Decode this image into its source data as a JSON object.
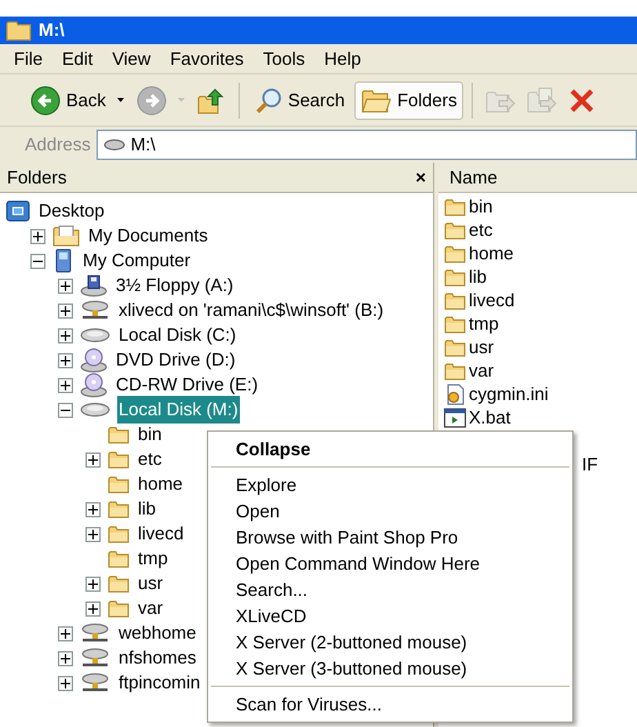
{
  "window": {
    "title": "M:\\"
  },
  "menu_bar": [
    "File",
    "Edit",
    "View",
    "Favorites",
    "Tools",
    "Help"
  ],
  "toolbar": [
    {
      "kind": "back",
      "label": "Back",
      "disabled": false
    },
    {
      "kind": "dropdown",
      "disabled": false
    },
    {
      "kind": "forward",
      "disabled": true
    },
    {
      "kind": "dropdown",
      "disabled": true
    },
    {
      "kind": "up",
      "disabled": false
    },
    {
      "kind": "separator"
    },
    {
      "kind": "search",
      "label": "Search",
      "selected": false
    },
    {
      "kind": "folders",
      "label": "Folders",
      "selected": true
    },
    {
      "kind": "separator"
    },
    {
      "kind": "move",
      "disabled": true
    },
    {
      "kind": "copy",
      "disabled": true
    },
    {
      "kind": "delete",
      "disabled": false
    }
  ],
  "address": {
    "label": "Address",
    "value": "M:\\"
  },
  "folders_pane": {
    "title": "Folders",
    "close": "×",
    "tree": [
      {
        "label": "Desktop",
        "kind": "desktop",
        "expandable": false,
        "selected": false,
        "children": [
          {
            "label": "My Documents",
            "kind": "documents",
            "expandable": true,
            "expanded": false,
            "selected": false
          },
          {
            "label": "My Computer",
            "kind": "computer",
            "expandable": true,
            "expanded": true,
            "selected": false,
            "children": [
              {
                "label": "3½ Floppy (A:)",
                "kind": "floppy",
                "expandable": true,
                "expanded": false,
                "selected": false
              },
              {
                "label": "xlivecd on 'ramani\\c$\\winsoft' (B:)",
                "kind": "network",
                "expandable": true,
                "expanded": false,
                "selected": false
              },
              {
                "label": "Local Disk (C:)",
                "kind": "disk",
                "expandable": true,
                "expanded": false,
                "selected": false
              },
              {
                "label": "DVD Drive (D:)",
                "kind": "dvd",
                "expandable": true,
                "expanded": false,
                "selected": false
              },
              {
                "label": "CD-RW Drive (E:)",
                "kind": "dvd",
                "expandable": true,
                "expanded": false,
                "selected": false
              },
              {
                "label": "Local Disk (M:)",
                "kind": "disk",
                "expandable": true,
                "expanded": true,
                "selected": true,
                "children": [
                  {
                    "label": "bin",
                    "kind": "folder",
                    "expandable": false,
                    "selected": false
                  },
                  {
                    "label": "etc",
                    "kind": "folder",
                    "expandable": true,
                    "expanded": false,
                    "selected": false
                  },
                  {
                    "label": "home",
                    "kind": "folder",
                    "expandable": false,
                    "selected": false
                  },
                  {
                    "label": "lib",
                    "kind": "folder",
                    "expandable": true,
                    "expanded": false,
                    "selected": false
                  },
                  {
                    "label": "livecd",
                    "kind": "folder",
                    "expandable": true,
                    "expanded": false,
                    "selected": false
                  },
                  {
                    "label": "tmp",
                    "kind": "folder",
                    "expandable": false,
                    "selected": false
                  },
                  {
                    "label": "usr",
                    "kind": "folder",
                    "expandable": true,
                    "expanded": false,
                    "selected": false
                  },
                  {
                    "label": "var",
                    "kind": "folder",
                    "expandable": true,
                    "expanded": false,
                    "selected": false
                  }
                ]
              },
              {
                "label": "webhome",
                "kind": "network",
                "expandable": true,
                "expanded": false,
                "selected": false
              },
              {
                "label": "nfshomes",
                "kind": "network",
                "expandable": true,
                "expanded": false,
                "selected": false
              },
              {
                "label": "ftpincomin",
                "kind": "network",
                "expandable": true,
                "expanded": false,
                "selected": false
              }
            ]
          }
        ]
      }
    ]
  },
  "file_list": {
    "columns": [
      "Name"
    ],
    "files": [
      {
        "name": "bin",
        "kind": "folder"
      },
      {
        "name": "etc",
        "kind": "folder"
      },
      {
        "name": "home",
        "kind": "folder"
      },
      {
        "name": "lib",
        "kind": "folder"
      },
      {
        "name": "livecd",
        "kind": "folder"
      },
      {
        "name": "tmp",
        "kind": "folder"
      },
      {
        "name": "usr",
        "kind": "folder"
      },
      {
        "name": "var",
        "kind": "folder"
      },
      {
        "name": "cygmin.ini",
        "kind": "settings"
      },
      {
        "name": "X.bat",
        "kind": "batch"
      }
    ],
    "column_2": "IF"
  },
  "context_menu": [
    {
      "kind": "default",
      "label": "Collapse"
    },
    {
      "kind": "separator"
    },
    {
      "kind": "item",
      "label": "Explore"
    },
    {
      "kind": "item",
      "label": "Open"
    },
    {
      "kind": "item",
      "label": "Browse with Paint Shop Pro"
    },
    {
      "kind": "item",
      "label": "Open Command Window Here"
    },
    {
      "kind": "item",
      "label": "Search..."
    },
    {
      "kind": "item",
      "label": "XLiveCD"
    },
    {
      "kind": "item",
      "label": "X Server (2-buttoned mouse)"
    },
    {
      "kind": "item",
      "label": "X Server (3-buttoned mouse)"
    },
    {
      "kind": "separator"
    },
    {
      "kind": "item",
      "label": "Scan for Viruses..."
    }
  ]
}
